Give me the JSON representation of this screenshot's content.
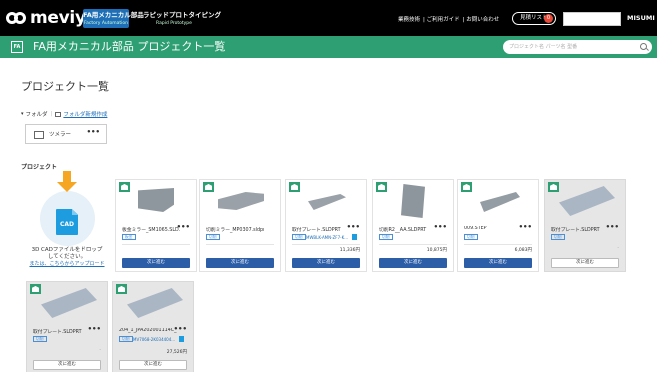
{
  "header": {
    "logo_text": "meviy",
    "service_fa_line1": "FA用メカニカル部品",
    "service_fa_line2": "Factory Automation",
    "service_rp_line1": "ラピッドプロトタイピング",
    "service_rp_line2": "Rapid Prototype",
    "links": [
      "業務技術",
      "ご利用ガイド",
      "お問い合わせ"
    ],
    "quote_list_label": "見積リスト",
    "quote_count": "0",
    "brand_right": "MISUMI"
  },
  "greenbar": {
    "badge": "FA",
    "title": "FA用メカニカル部品 プロジェクト一覧",
    "search_placeholder": "プロジェクト名 パーツ名 型番"
  },
  "main": {
    "page_title": "プロジェクト一覧",
    "folder_label": "フォルダ",
    "new_folder_link": "フォルダ新規作成",
    "folder_name": "ツメラー",
    "more_symbol": "•••",
    "section_projects": "プロジェクト",
    "upload": {
      "doc_label": "CAD",
      "text_line1": "3D CADファイルをドロップ",
      "text_line2": "してください。",
      "link": "または、こちらからアップロード"
    },
    "projects": [
      {
        "name": "板金ミラー_SM1065.SLD...",
        "tag": "板金",
        "subtag": "",
        "price": "",
        "button": "次に進む",
        "grey": false
      },
      {
        "name": "切削ミラー_MP0307.sldprt",
        "tag": "切削",
        "subtag": "",
        "price": "",
        "button": "次に進む",
        "grey": false
      },
      {
        "name": "取付プレート.SLDPRT",
        "tag": "切削",
        "subtag": "MWBLK-AMN-ZF7-K...",
        "price": "11,336円",
        "button": "次に進む",
        "grey": false
      },
      {
        "name": "切削R2__AA.SLDPRT",
        "tag": "切削",
        "subtag": "",
        "price": "10,875円",
        "button": "次に進む",
        "grey": false
      },
      {
        "name": "009.STEP",
        "tag": "切削",
        "subtag": "",
        "price": "6,083円",
        "button": "次に進む",
        "grey": false
      },
      {
        "name": "取付プレート.SLDPRT",
        "tag": "切削",
        "subtag": "",
        "price": "-",
        "button": "次に進む",
        "grey": true
      },
      {
        "name": "取付プレート.SLDPRT",
        "tag": "切削",
        "subtag": "",
        "price": "-",
        "button": "次に進む",
        "grey": true
      },
      {
        "name": "204_1_JPA202001114C_...",
        "tag": "切削",
        "subtag": "MV7068-2K034404...",
        "price": "27,526円",
        "button": "次に進む",
        "grey": true
      }
    ]
  }
}
